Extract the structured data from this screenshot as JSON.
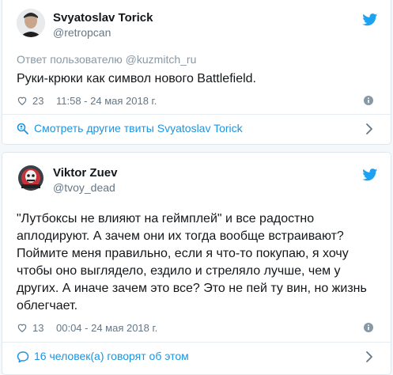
{
  "tweets": [
    {
      "author": {
        "name": "Svyatoslav Torick",
        "handle": "@retropcan"
      },
      "reply_prefix": "Ответ пользователю",
      "reply_mention": "@kuzmitch_ru",
      "text": "Руки-крюки как символ нового Battlefield.",
      "likes": "23",
      "timestamp": "11:58 - 24 мая 2018 г.",
      "footer_link": "Смотреть другие твиты Svyatoslav Torick"
    },
    {
      "author": {
        "name": "Viktor Zuev",
        "handle": "@tvoy_dead"
      },
      "text": "\"Лутбоксы не влияют на геймплей\" и все радостно аплодируют. А зачем они их тогда вообще встраивают? Поймите меня правильно, если я что-то покупаю, я хочу чтобы оно выглядело, ездило и стреляло лучше, чем у других. А иначе зачем это все? Это не пей ту вин, но жизнь облегчает.",
      "likes": "13",
      "timestamp": "00:04 - 24 мая 2018 г.",
      "footer_link": "16 человек(а) говорят об этом"
    }
  ],
  "colors": {
    "twitter_blue": "#1da1f2",
    "link_blue": "#1b95e0",
    "muted": "#657786"
  },
  "icons": [
    "twitter-bird-icon",
    "heart-icon",
    "info-icon",
    "search-people-icon",
    "chat-icon",
    "chevron-right-icon"
  ]
}
